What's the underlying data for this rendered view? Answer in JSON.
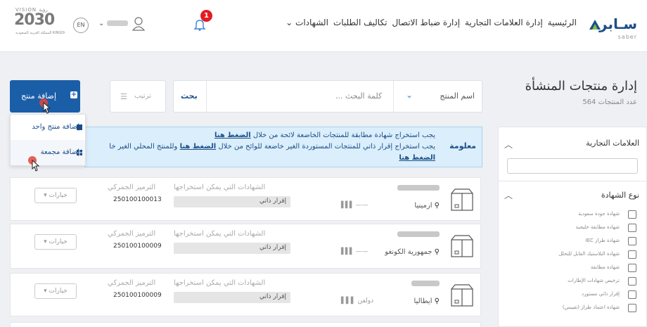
{
  "header": {
    "logo_text": "سـابر",
    "logo_sub": "saber",
    "nav": [
      "الرئيسية",
      "إدارة العلامات التجارية",
      "إدارة ضباط الاتصال",
      "تكاليف الطلبات",
      "الشهادات"
    ],
    "notification_count": "1",
    "user_name": "~",
    "lang": "EN",
    "vision_top": "VISION رؤية",
    "vision_year": "2030",
    "vision_bottom": "المملكة العربية السعودية KINGDOM OF SAUDI ARABIA"
  },
  "page": {
    "title": "إدارة منتجات المنشأة",
    "count": "عدد المنتجات 564"
  },
  "search": {
    "field_label": "اسم المنتج",
    "placeholder": "كلمة البحث ...",
    "button": "بحث"
  },
  "sort": {
    "label": "ترتيب"
  },
  "add_product": {
    "label": "إضافة منتج",
    "menu": [
      "إضافة منتج واحد",
      "إضافة مجمعة"
    ]
  },
  "alert": {
    "title": "معلومة",
    "line1_text": "يجب استخراج شهادة مطابقة للمنتجات الخاضعة لائحة من خلال",
    "line1_link": "الضغط هنا",
    "line2_text": "يجب استخراج إقرار ذاتي للمنتجات المستوردة الغير خاضعة للوائح من خلال",
    "line2_link": "الضغط هنا",
    "line2_tail": "وللمنتج المحلي الغير خا",
    "line3_link": "الضغط هنا"
  },
  "products": [
    {
      "origin": "ارمينيا",
      "brand": "——",
      "certs_label": "الشهادات التي يمكن استخراجها",
      "cert": "إقرار ذاتي",
      "hs_label": "الترميز الجمركي",
      "hs": "250100100013",
      "options": "خيارات"
    },
    {
      "origin": "جمهورية الكونغو",
      "brand": "——",
      "certs_label": "الشهادات التي يمكن استخراجها",
      "cert": "إقرار ذاتي",
      "hs_label": "الترميز الجمركي",
      "hs": "250100100009",
      "options": "خيارات"
    },
    {
      "origin": "ايطاليا",
      "brand": "دولفن",
      "certs_label": "الشهادات التي يمكن استخراجها",
      "cert": "إقرار ذاتي",
      "hs_label": "الترميز الجمركي",
      "hs": "250100100009",
      "options": "خيارات"
    }
  ],
  "filters": {
    "brands_title": "العلامات التجارية",
    "cert_type_title": "نوع الشهادة",
    "cert_types": [
      "شهادة جودة سعودية",
      "شهادة مطابقة خليجية",
      "شهادة طراز IEC",
      "شهادة البلاستيك القابل للتحلل",
      "شهادة مطابقة",
      "ترخيص شهادات الإطارات",
      "إقرار ذاتي مستورد",
      "شهادة اعتماد طراز (تقييس)"
    ]
  }
}
